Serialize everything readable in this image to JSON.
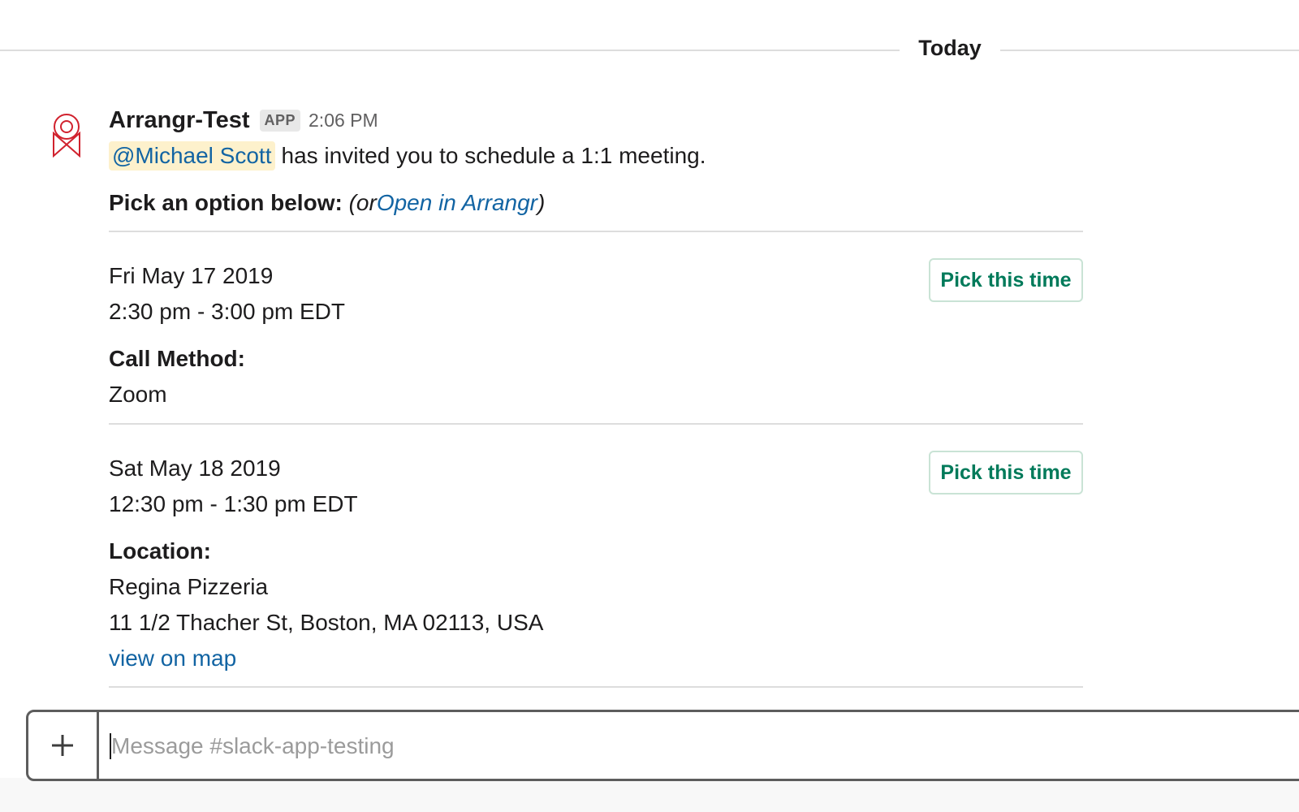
{
  "day_divider": {
    "label": "Today"
  },
  "message": {
    "sender": "Arrangr-Test",
    "badge": "APP",
    "time": "2:06 PM",
    "mention": "@Michael Scott",
    "text": "has invited you to schedule a 1:1 meeting.",
    "pick_prefix": "Pick an option below:",
    "pick_or": "(or",
    "pick_link": "Open in Arrangr",
    "pick_close": ")"
  },
  "options": [
    {
      "date": "Fri May 17 2019",
      "time": "2:30 pm - 3:00 pm EDT",
      "detail_label": "Call Method:",
      "detail_lines": [
        "Zoom"
      ],
      "button": "Pick this time"
    },
    {
      "date": "Sat May 18 2019",
      "time": "12:30 pm - 1:30 pm EDT",
      "detail_label": "Location:",
      "detail_lines": [
        "Regina Pizzeria",
        "11 1/2 Thacher St, Boston, MA 02113, USA"
      ],
      "map_link": "view on map",
      "button": "Pick this time"
    }
  ],
  "composer": {
    "placeholder": "Message #slack-app-testing",
    "attach_icon": "plus-icon"
  },
  "colors": {
    "link": "#1264a3",
    "mention_bg": "#fdf1cc",
    "button_text": "#007a5a",
    "avatar": "#d1222e"
  }
}
